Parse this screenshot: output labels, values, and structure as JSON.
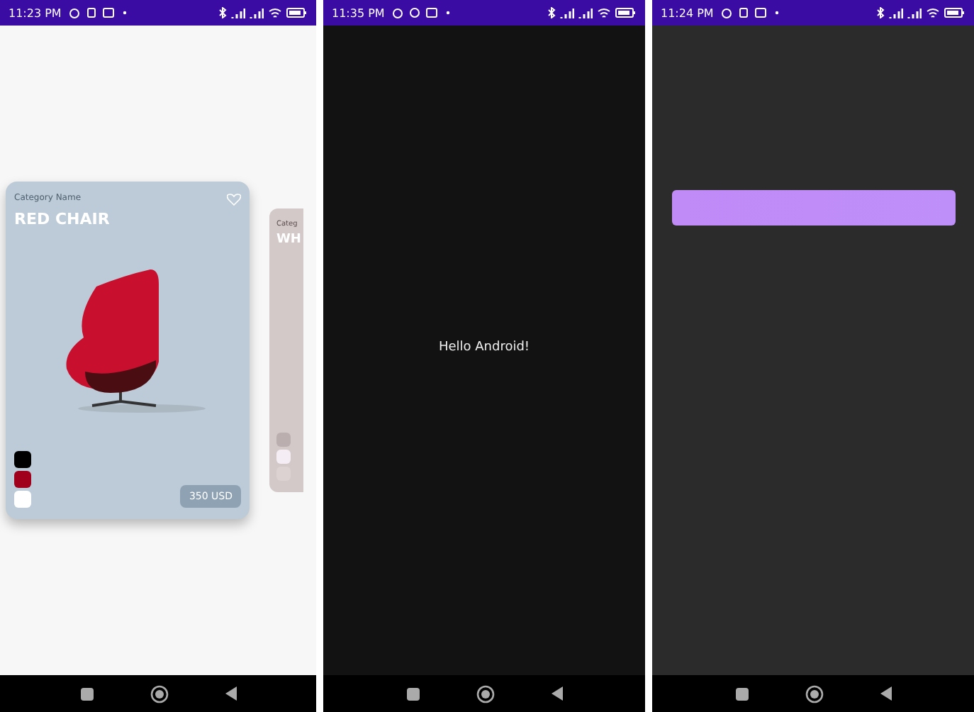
{
  "phones": [
    {
      "kind": "catalog",
      "status_time": "11:23 PM",
      "cards": [
        {
          "category": "Category Name",
          "title": "RED CHAIR",
          "price": "350 USD",
          "favorite": false,
          "swatches": [
            {
              "color": "#000000"
            },
            {
              "color": "#a0001c"
            },
            {
              "color": "#ffffff"
            }
          ]
        },
        {
          "category": "Categ",
          "title": "WH",
          "swatches": [
            {
              "color": "#bbaeae"
            },
            {
              "color": "#f4eef4"
            },
            {
              "color": "#ddd2d2"
            }
          ]
        }
      ]
    },
    {
      "kind": "hello",
      "status_time": "11:35 PM",
      "message": "Hello Android!"
    },
    {
      "kind": "button",
      "status_time": "11:24 PM"
    }
  ]
}
